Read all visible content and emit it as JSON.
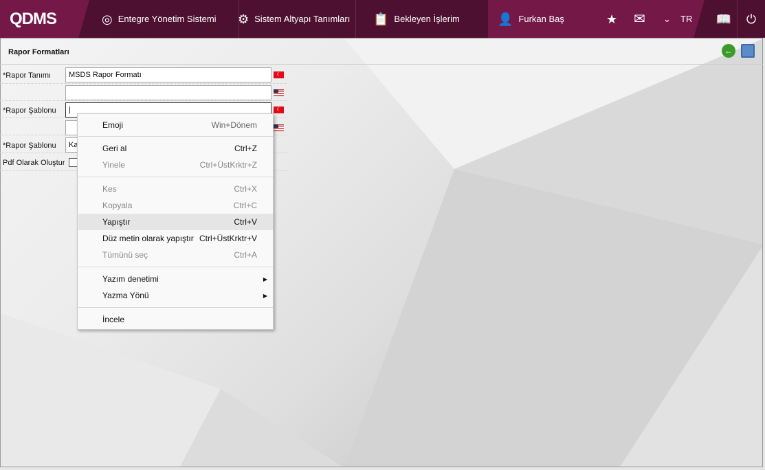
{
  "header": {
    "logo": "QDMS",
    "nav": [
      {
        "label": "Entegre Yönetim Sistemi",
        "icon": "q-logo-icon"
      },
      {
        "label": "Sistem Altyapı Tanımları",
        "icon": "gear-icon"
      },
      {
        "label": "Bekleyen İşlerim",
        "icon": "clipboard-icon"
      }
    ],
    "user": "Furkan Baş",
    "language": "TR"
  },
  "page": {
    "title": "Rapor Formatları"
  },
  "form": {
    "rapor_tanimi_label": "*Rapor Tanımı",
    "rapor_tanimi_tr": "MSDS Rapor Formatı",
    "rapor_tanimi_en": "",
    "rapor_sablonu_label": "*Rapor Şablonu",
    "rapor_sablonu_tr": "",
    "rapor_sablonu_en": "",
    "rapor_sablonu2_label": "*Rapor Şablonu",
    "rapor_sablonu2_value": "Ka",
    "pdf_label": "Pdf Olarak Oluştur",
    "pdf_checked": false
  },
  "context_menu": [
    {
      "label": "Emoji",
      "shortcut": "Win+Dönem"
    },
    {
      "label": "Geri al",
      "shortcut": "Ctrl+Z"
    },
    {
      "label": "Yinele",
      "shortcut": "Ctrl+ÜstKrktr+Z",
      "disabled": true
    },
    {
      "label": "Kes",
      "shortcut": "Ctrl+X",
      "disabled": true
    },
    {
      "label": "Kopyala",
      "shortcut": "Ctrl+C",
      "disabled": true
    },
    {
      "label": "Yapıştır",
      "shortcut": "Ctrl+V",
      "highlighted": true
    },
    {
      "label": "Düz metin olarak yapıştır",
      "shortcut": "Ctrl+ÜstKrktr+V"
    },
    {
      "label": "Tümünü seç",
      "shortcut": "Ctrl+A",
      "disabled": true
    },
    {
      "label": "Yazım denetimi",
      "submenu": true
    },
    {
      "label": "Yazma Yönü",
      "submenu": true
    },
    {
      "label": "İncele"
    }
  ],
  "colors": {
    "header_dark": "#4d1030",
    "header_accent": "#741848"
  }
}
